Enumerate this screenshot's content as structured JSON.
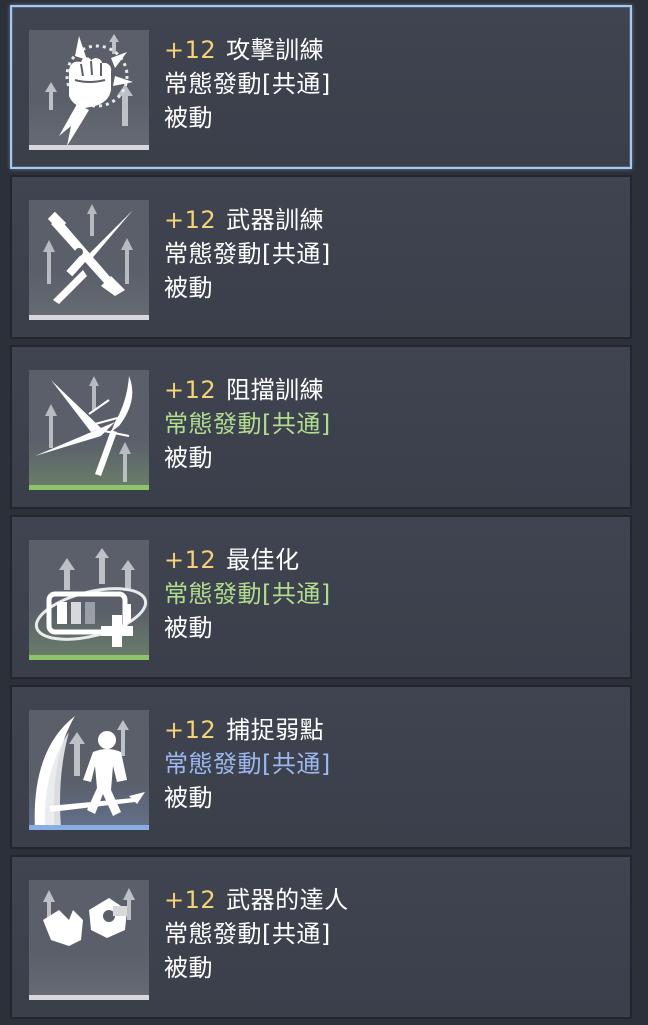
{
  "skills": [
    {
      "level": "+12",
      "name": "攻擊訓練",
      "trigger": "常態發動[共通]",
      "trigger_color": "white",
      "type": "被動",
      "icon": "fist-icon",
      "selected": true
    },
    {
      "level": "+12",
      "name": "武器訓練",
      "trigger": "常態發動[共通]",
      "trigger_color": "white",
      "type": "被動",
      "icon": "crossed-weapons-icon",
      "selected": false
    },
    {
      "level": "+12",
      "name": "阻擋訓練",
      "trigger": "常態發動[共通]",
      "trigger_color": "green",
      "type": "被動",
      "icon": "sword-block-icon",
      "selected": false
    },
    {
      "level": "+12",
      "name": "最佳化",
      "trigger": "常態發動[共通]",
      "trigger_color": "green",
      "type": "被動",
      "icon": "battery-plus-icon",
      "selected": false
    },
    {
      "level": "+12",
      "name": "捕捉弱點",
      "trigger": "常態發動[共通]",
      "trigger_color": "blue",
      "type": "被動",
      "icon": "slash-fighter-icon",
      "selected": false
    },
    {
      "level": "+12",
      "name": "武器的達人",
      "trigger": "常態發動[共通]",
      "trigger_color": "white",
      "type": "被動",
      "icon": "gauntlet-icon",
      "selected": false
    }
  ],
  "colors": {
    "level": "#f4d27a",
    "trigger_white": "#ffffff",
    "trigger_green": "#b2dd8f",
    "trigger_blue": "#9db8f0",
    "selected_border": "#a7c8ec"
  }
}
